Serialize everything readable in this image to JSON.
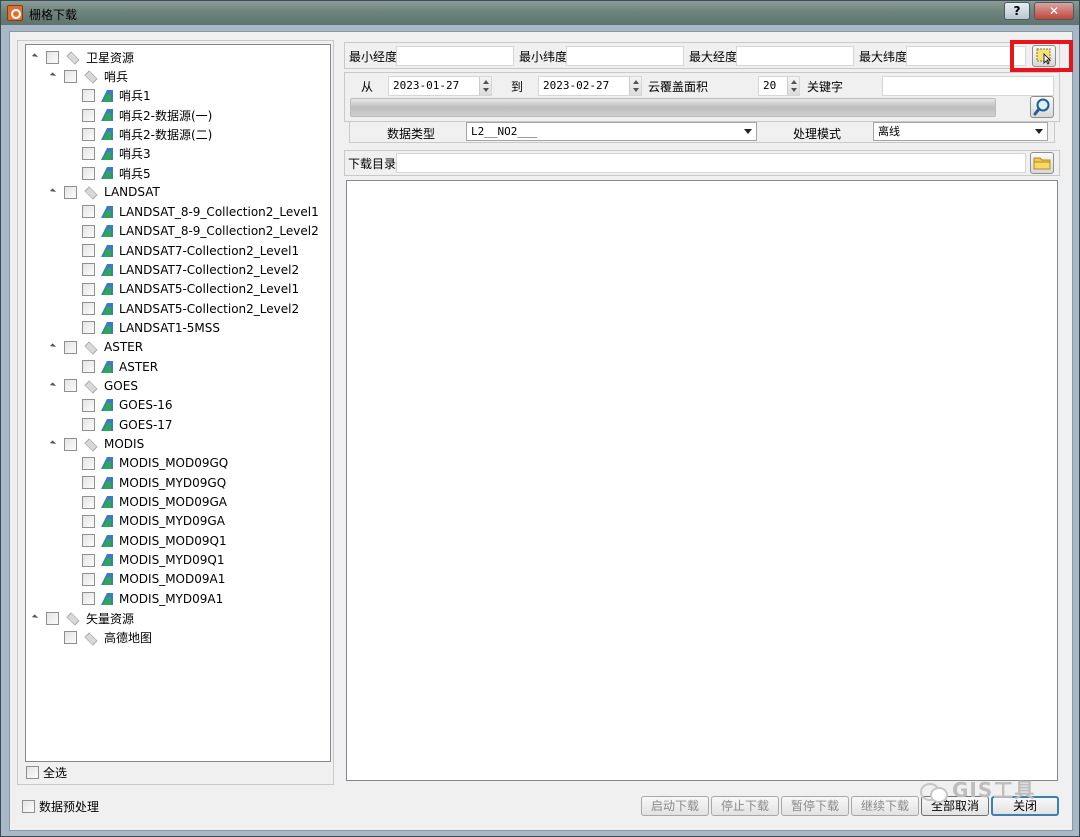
{
  "window": {
    "title": "栅格下载",
    "help_label": "?",
    "close_label": "✕"
  },
  "tree": {
    "nodes": [
      {
        "label": "卫星资源",
        "level": 0,
        "kind": "group",
        "expanded": true
      },
      {
        "label": "哨兵",
        "level": 1,
        "kind": "group",
        "expanded": true
      },
      {
        "label": "哨兵1",
        "level": 2,
        "kind": "raster"
      },
      {
        "label": "哨兵2-数据源(一)",
        "level": 2,
        "kind": "raster"
      },
      {
        "label": "哨兵2-数据源(二)",
        "level": 2,
        "kind": "raster"
      },
      {
        "label": "哨兵3",
        "level": 2,
        "kind": "raster"
      },
      {
        "label": "哨兵5",
        "level": 2,
        "kind": "raster"
      },
      {
        "label": "LANDSAT",
        "level": 1,
        "kind": "group",
        "expanded": true
      },
      {
        "label": "LANDSAT_8-9_Collection2_Level1",
        "level": 2,
        "kind": "raster"
      },
      {
        "label": "LANDSAT_8-9_Collection2_Level2",
        "level": 2,
        "kind": "raster"
      },
      {
        "label": "LANDSAT7-Collection2_Level1",
        "level": 2,
        "kind": "raster"
      },
      {
        "label": "LANDSAT7-Collection2_Level2",
        "level": 2,
        "kind": "raster"
      },
      {
        "label": "LANDSAT5-Collection2_Level1",
        "level": 2,
        "kind": "raster"
      },
      {
        "label": "LANDSAT5-Collection2_Level2",
        "level": 2,
        "kind": "raster"
      },
      {
        "label": "LANDSAT1-5MSS",
        "level": 2,
        "kind": "raster"
      },
      {
        "label": "ASTER",
        "level": 1,
        "kind": "group",
        "expanded": true
      },
      {
        "label": "ASTER",
        "level": 2,
        "kind": "raster"
      },
      {
        "label": "GOES",
        "level": 1,
        "kind": "group",
        "expanded": true
      },
      {
        "label": "GOES-16",
        "level": 2,
        "kind": "raster"
      },
      {
        "label": "GOES-17",
        "level": 2,
        "kind": "raster"
      },
      {
        "label": "MODIS",
        "level": 1,
        "kind": "group",
        "expanded": true
      },
      {
        "label": "MODIS_MOD09GQ",
        "level": 2,
        "kind": "raster"
      },
      {
        "label": "MODIS_MYD09GQ",
        "level": 2,
        "kind": "raster"
      },
      {
        "label": "MODIS_MOD09GA",
        "level": 2,
        "kind": "raster"
      },
      {
        "label": "MODIS_MYD09GA",
        "level": 2,
        "kind": "raster"
      },
      {
        "label": "MODIS_MOD09Q1",
        "level": 2,
        "kind": "raster"
      },
      {
        "label": "MODIS_MYD09Q1",
        "level": 2,
        "kind": "raster"
      },
      {
        "label": "MODIS_MOD09A1",
        "level": 2,
        "kind": "raster"
      },
      {
        "label": "MODIS_MYD09A1",
        "level": 2,
        "kind": "raster"
      },
      {
        "label": "矢量资源",
        "level": 0,
        "kind": "group",
        "expanded": true
      },
      {
        "label": "高德地图",
        "level": 1,
        "kind": "group",
        "expanded": false
      }
    ],
    "select_all_label": "全选"
  },
  "extent": {
    "min_lon_label": "最小经度",
    "min_lon_value": "",
    "min_lat_label": "最小纬度",
    "min_lat_value": "",
    "max_lon_label": "最大经度",
    "max_lon_value": "",
    "max_lat_label": "最大纬度",
    "max_lat_value": "",
    "draw_extent_icon": "select-extent-icon"
  },
  "filters": {
    "from_label": "从",
    "from_value": "2023-01-27",
    "to_label": "到",
    "to_value": "2023-02-27",
    "cloud_label": "云覆盖面积",
    "cloud_value": "20",
    "keyword_label": "关键字",
    "keyword_value": "",
    "search_icon": "search-icon"
  },
  "options": {
    "data_type_label": "数据类型",
    "data_type_value": "L2__NO2___",
    "mode_label": "处理模式",
    "mode_value": "离线"
  },
  "download": {
    "dir_label": "下载目录",
    "dir_value": "",
    "folder_icon": "folder-icon"
  },
  "footer": {
    "preprocess_label": "数据预处理",
    "start_label": "启动下载",
    "stop_label": "停止下载",
    "pause_label": "暂停下载",
    "resume_label": "继续下载",
    "cancel_all_label": "全部取消",
    "close_label": "关闭"
  },
  "watermark": "GIS工具",
  "colors": {
    "highlight": "#e8141c",
    "focus_border": "#3c7fb1"
  }
}
